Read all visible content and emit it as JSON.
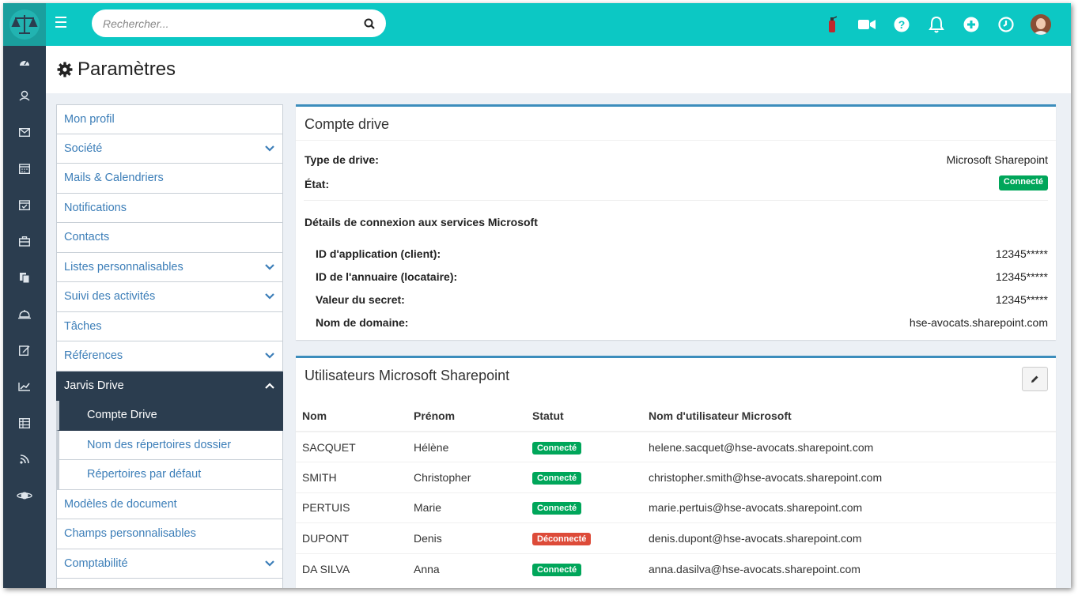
{
  "topbar": {
    "search_placeholder": "Rechercher...",
    "icons": [
      "fire-extinguisher-icon",
      "video-icon",
      "help-icon",
      "bell-icon",
      "add-icon",
      "clock-icon"
    ],
    "accent_color": "#0cc8c4"
  },
  "sidebar": {
    "icons": [
      "dashboard-icon",
      "contacts-icon",
      "mail-icon",
      "calendar-icon",
      "calendar-check-icon",
      "briefcase-icon",
      "documents-icon",
      "bell-service-icon",
      "edit-icon",
      "chart-icon",
      "table-icon",
      "rss-icon",
      "planet-icon"
    ]
  },
  "page": {
    "title": "Paramètres"
  },
  "menu": {
    "items": [
      {
        "label": "Mon profil",
        "chevron": "",
        "sub": false,
        "active": false
      },
      {
        "label": "Société",
        "chevron": "down",
        "sub": false,
        "active": false
      },
      {
        "label": "Mails & Calendriers",
        "chevron": "",
        "sub": false,
        "active": false
      },
      {
        "label": "Notifications",
        "chevron": "",
        "sub": false,
        "active": false
      },
      {
        "label": "Contacts",
        "chevron": "",
        "sub": false,
        "active": false
      },
      {
        "label": "Listes personnalisables",
        "chevron": "down",
        "sub": false,
        "active": false
      },
      {
        "label": "Suivi des activités",
        "chevron": "down",
        "sub": false,
        "active": false
      },
      {
        "label": "Tâches",
        "chevron": "",
        "sub": false,
        "active": false
      },
      {
        "label": "Références",
        "chevron": "down",
        "sub": false,
        "active": false
      },
      {
        "label": "Jarvis Drive",
        "chevron": "up",
        "sub": false,
        "active": true
      },
      {
        "label": "Compte Drive",
        "chevron": "",
        "sub": true,
        "active": true
      },
      {
        "label": "Nom des répertoires dossier",
        "chevron": "",
        "sub": true,
        "active": false
      },
      {
        "label": "Répertoires par défaut",
        "chevron": "",
        "sub": true,
        "active": false
      },
      {
        "label": "Modèles de document",
        "chevron": "",
        "sub": false,
        "active": false
      },
      {
        "label": "Champs personnalisables",
        "chevron": "",
        "sub": false,
        "active": false
      },
      {
        "label": "Comptabilité",
        "chevron": "down",
        "sub": false,
        "active": false
      }
    ]
  },
  "drive": {
    "title": "Compte drive",
    "type_label": "Type de drive:",
    "type_value": "Microsoft Sharepoint",
    "state_label": "État:",
    "state_value": "Connecté",
    "details_title": "Détails de connexion aux services Microsoft",
    "app_id_label": "ID d'application (client):",
    "app_id_value": "12345*****",
    "tenant_label": "ID de l'annuaire (locataire):",
    "tenant_value": "12345*****",
    "secret_label": "Valeur du secret:",
    "secret_value": "12345*****",
    "domain_label": "Nom de domaine:",
    "domain_value": "hse-avocats.sharepoint.com"
  },
  "users": {
    "title": "Utilisateurs Microsoft Sharepoint",
    "columns": [
      "Nom",
      "Prénom",
      "Statut",
      "Nom d'utilisateur Microsoft"
    ],
    "rows": [
      {
        "nom": "SACQUET",
        "prenom": "Hélène",
        "statut": "Connecté",
        "ok": true,
        "email": "helene.sacquet@hse-avocats.sharepoint.com"
      },
      {
        "nom": "SMITH",
        "prenom": "Christopher",
        "statut": "Connecté",
        "ok": true,
        "email": "christopher.smith@hse-avocats.sharepoint.com"
      },
      {
        "nom": "PERTUIS",
        "prenom": "Marie",
        "statut": "Connecté",
        "ok": true,
        "email": "marie.pertuis@hse-avocats.sharepoint.com"
      },
      {
        "nom": "DUPONT",
        "prenom": "Denis",
        "statut": "Déconnecté",
        "ok": false,
        "email": "denis.dupont@hse-avocats.sharepoint.com"
      },
      {
        "nom": "DA SILVA",
        "prenom": "Anna",
        "statut": "Connecté",
        "ok": true,
        "email": "anna.dasilva@hse-avocats.sharepoint.com"
      }
    ]
  }
}
